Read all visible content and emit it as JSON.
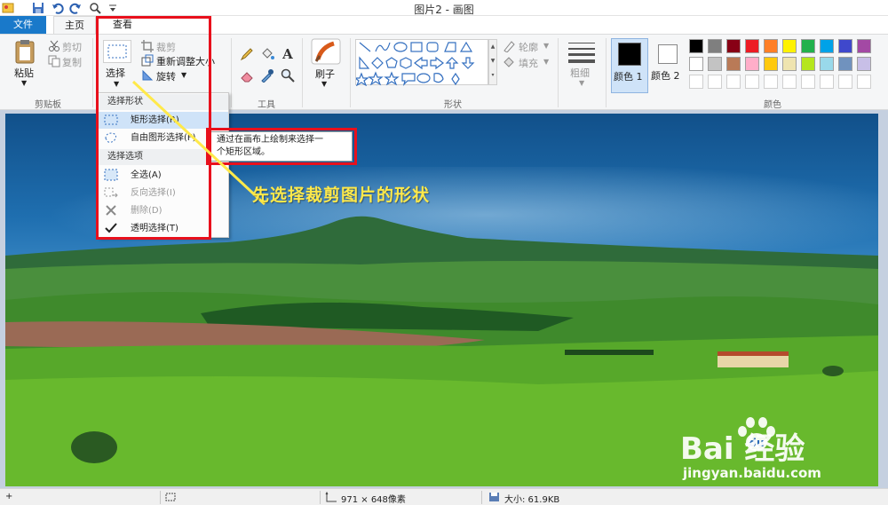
{
  "window": {
    "title": "图片2 - 画图"
  },
  "quick_access": {
    "icons": [
      "app-icon",
      "save-icon",
      "undo-icon",
      "redo-icon",
      "zoom-icon",
      "customize-icon"
    ]
  },
  "tabs": [
    {
      "label": "文件"
    },
    {
      "label": "主页"
    },
    {
      "label": "查看"
    }
  ],
  "ribbon": {
    "clipboard": {
      "paste_label": "粘贴",
      "cut_label": "剪切",
      "copy_label": "复制",
      "group_label": "剪贴板"
    },
    "image": {
      "select_label": "选择",
      "crop_label": "裁剪",
      "resize_label": "重新调整大小",
      "rotate_label": "旋转"
    },
    "tools": {
      "group_label": "工具"
    },
    "brushes": {
      "label": "刷子"
    },
    "shapes": {
      "outline_label": "轮廓",
      "fill_label": "填充",
      "group_label": "形状"
    },
    "size": {
      "label": "粗细"
    },
    "colors": {
      "color1_label": "颜色 1",
      "color2_label": "颜色 2",
      "group_label": "颜色",
      "color1": "#000000",
      "color2": "#ffffff",
      "palette_row1": [
        "#000000",
        "#7f7f7f",
        "#880015",
        "#ed1c24",
        "#ff7f27",
        "#fff200",
        "#22b14c",
        "#00a2e8",
        "#3f48cc",
        "#a349a4"
      ],
      "palette_row2": [
        "#ffffff",
        "#c3c3c3",
        "#b97a57",
        "#ffaec9",
        "#ffc90e",
        "#efe4b0",
        "#b5e61d",
        "#99d9ea",
        "#7092be",
        "#c8bfe7"
      ]
    }
  },
  "dropdown": {
    "shape_header": "选择形状",
    "rect_select": "矩形选择(R)",
    "free_select": "自由图形选择(F)",
    "options_header": "选择选项",
    "select_all": "全选(A)",
    "invert": "反向选择(I)",
    "delete": "删除(D)",
    "transparent": "透明选择(T)"
  },
  "tooltip": {
    "line1": "通过在画布上绘制来选择一",
    "line2": "个矩形区域。"
  },
  "annotation": {
    "text": "先选择裁剪图片的形状"
  },
  "statusbar": {
    "dimensions": "971 × 648像素",
    "size_label": "大小: 61.9KB"
  },
  "watermark": {
    "brand_text": "Bai  经验",
    "url": "jingyan.baidu.com"
  },
  "accent": {
    "red_frame": "#e8101c",
    "annotation_yellow": "#ffe94a"
  }
}
